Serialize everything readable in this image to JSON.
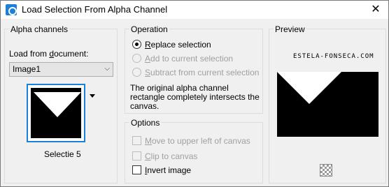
{
  "window": {
    "title": "Load Selection From Alpha Channel",
    "close_label": "✕"
  },
  "alpha": {
    "legend": "Alpha channels",
    "load_label_pre": "Load from ",
    "load_label_u": "d",
    "load_label_post": "ocument:",
    "document_value": "Image1",
    "channel_name": "Selectie 5"
  },
  "operation": {
    "legend": "Operation",
    "replace": {
      "u": "R",
      "rest": "eplace selection"
    },
    "add": {
      "u": "A",
      "rest": "dd to current selection"
    },
    "subtract": {
      "u": "S",
      "rest": "ubtract from current selection"
    },
    "message_l1": "The original alpha channel",
    "message_l2": "rectangle completely intersects the",
    "message_l3": "canvas."
  },
  "options": {
    "legend": "Options",
    "move": {
      "u": "M",
      "rest": "ove to upper left of canvas"
    },
    "clip": {
      "u": "C",
      "rest": "lip to canvas"
    },
    "invert": {
      "u": "I",
      "rest": "nvert image"
    }
  },
  "preview": {
    "legend": "Preview",
    "watermark": "ESTELA-FONSECA.COM"
  }
}
